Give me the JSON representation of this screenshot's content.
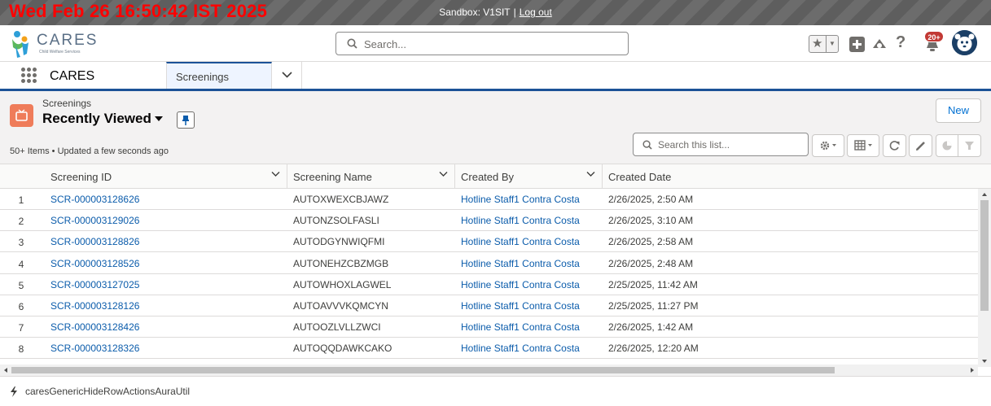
{
  "banner": {
    "clock": "Wed Feb 26 16:50:42 IST 2025",
    "sandbox_label": "Sandbox: V1SIT",
    "separator": "|",
    "logout": "Log out"
  },
  "header": {
    "logo_text": "CARES",
    "logo_subtitle": "Child Welfare Services",
    "search_placeholder": "Search...",
    "notification_count": "20+",
    "icons": [
      "star-icon",
      "add-icon",
      "cloud-icon",
      "help-icon",
      "bell-icon",
      "avatar"
    ]
  },
  "appnav": {
    "app_name": "CARES",
    "tabs": [
      {
        "label": "Screenings"
      }
    ]
  },
  "listview": {
    "object_label": "Screenings",
    "view_name": "Recently Viewed",
    "new_button": "New",
    "status": "50+ Items • Updated a few seconds ago",
    "search_placeholder": "Search this list..."
  },
  "table": {
    "columns": [
      "Screening ID",
      "Screening Name",
      "Created By",
      "Created Date"
    ],
    "rows": [
      {
        "num": "1",
        "id": "SCR-000003128626",
        "name": "AUTOXWEXCBJAWZ",
        "created_by": "Hotline Staff1 Contra Costa",
        "created_date": "2/26/2025, 2:50 AM"
      },
      {
        "num": "2",
        "id": "SCR-000003129026",
        "name": "AUTONZSOLFASLI",
        "created_by": "Hotline Staff1 Contra Costa",
        "created_date": "2/26/2025, 3:10 AM"
      },
      {
        "num": "3",
        "id": "SCR-000003128826",
        "name": "AUTODGYNWIQFMI",
        "created_by": "Hotline Staff1 Contra Costa",
        "created_date": "2/26/2025, 2:58 AM"
      },
      {
        "num": "4",
        "id": "SCR-000003128526",
        "name": "AUTONEHZCBZMGB",
        "created_by": "Hotline Staff1 Contra Costa",
        "created_date": "2/26/2025, 2:48 AM"
      },
      {
        "num": "5",
        "id": "SCR-000003127025",
        "name": "AUTOWHOXLAGWEL",
        "created_by": "Hotline Staff1 Contra Costa",
        "created_date": "2/25/2025, 11:42 AM"
      },
      {
        "num": "6",
        "id": "SCR-000003128126",
        "name": "AUTOAVVVKQMCYN",
        "created_by": "Hotline Staff1 Contra Costa",
        "created_date": "2/25/2025, 11:27 PM"
      },
      {
        "num": "7",
        "id": "SCR-000003128426",
        "name": "AUTOOZLVLLZWCI",
        "created_by": "Hotline Staff1 Contra Costa",
        "created_date": "2/26/2025, 1:42 AM"
      },
      {
        "num": "8",
        "id": "SCR-000003128326",
        "name": "AUTOQQDAWKCAKO",
        "created_by": "Hotline Staff1 Contra Costa",
        "created_date": "2/26/2025, 12:20 AM"
      }
    ]
  },
  "footer": {
    "component": "caresGenericHideRowActionsAuraUtil"
  }
}
